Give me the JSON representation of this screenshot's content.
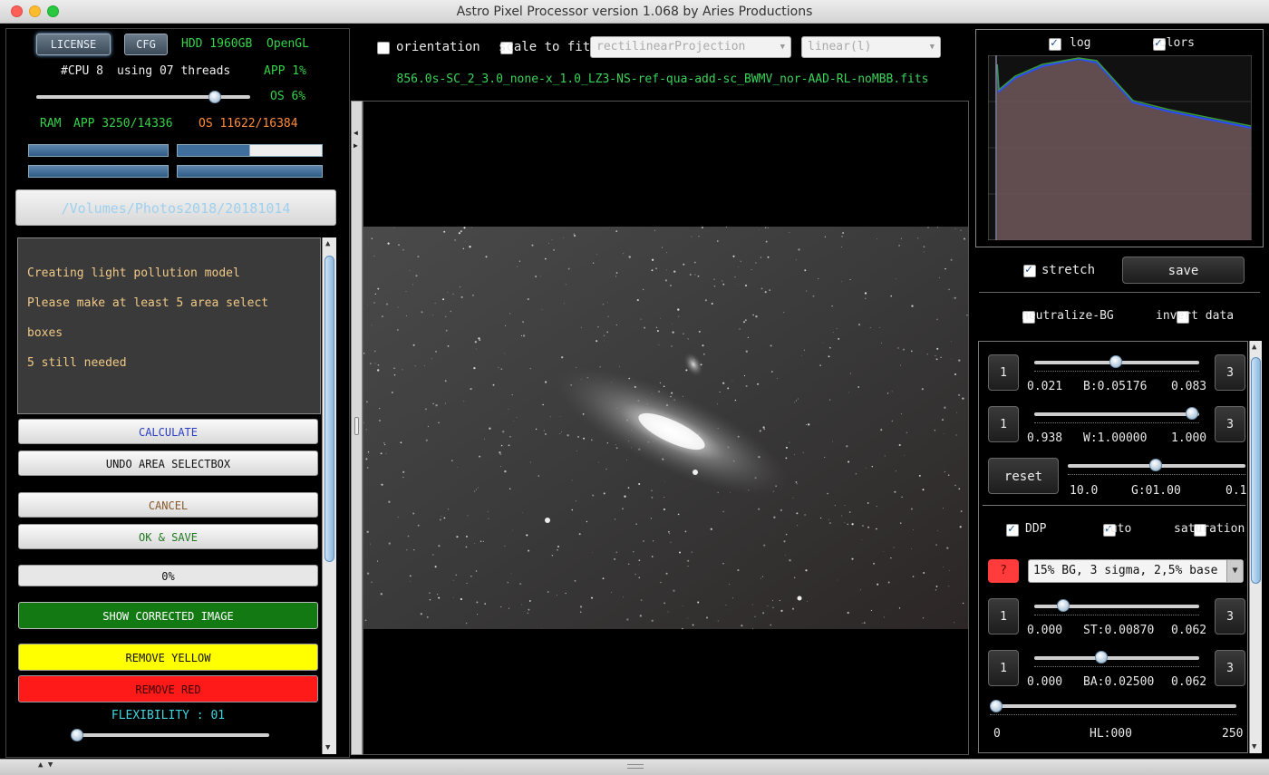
{
  "window": {
    "title": "Astro Pixel Processor version 1.068 by Aries Productions"
  },
  "top": {
    "license": "LICENSE",
    "cfg": "CFG",
    "hdd": "HDD 1960GB",
    "opengl": "OpenGL",
    "cpu": "#CPU 8",
    "threads": "using 07 threads",
    "app_pct": "APP 1%",
    "os_pct": "OS 6%",
    "ram": "RAM",
    "ram_app": "APP 3250/14336",
    "ram_os": "OS 11622/16384",
    "path": "/Volumes/Photos2018/20181014"
  },
  "log": {
    "lines": [
      "Creating light pollution model",
      "Please make at least 5 area select boxes",
      "5 still needed"
    ]
  },
  "actions": {
    "calculate": "CALCULATE",
    "undo": "UNDO AREA SELECTBOX",
    "cancel": "CANCEL",
    "ok_save": "OK & SAVE",
    "progress": "0%",
    "show_corrected": "SHOW CORRECTED IMAGE",
    "remove_yellow": "REMOVE YELLOW",
    "remove_red": "REMOVE RED",
    "flexibility": "FLEXIBILITY : 01"
  },
  "viewer": {
    "orientation": "orientation",
    "scale_to_fit": "scale to fit",
    "projection": "rectilinearProjection",
    "stretch_mode": "linear(l)",
    "filename": "856.0s-SC_2_3.0_none-x_1.0_LZ3-NS-ref-qua-add-sc_BWMV_nor-AAD-RL-noMBB.fits"
  },
  "histogram": {
    "log": "log",
    "colors": "colors"
  },
  "right": {
    "stretch": "stretch",
    "save": "save",
    "neutralize": "neutralize-BG",
    "invert": "invert data",
    "b_min": "0.021",
    "b_val": "B:0.05176",
    "b_max": "0.083",
    "w_min": "0.938",
    "w_val": "W:1.00000",
    "w_max": "1.000",
    "reset": "reset",
    "g_min": "10.0",
    "g_val": "G:01.00",
    "g_max": "0.1",
    "ddp": "DDP",
    "auto": "auto",
    "saturation": "saturation",
    "help": "?",
    "preset": "15% BG, 3 sigma, 2,5% base",
    "st_min": "0.000",
    "st_val": "ST:0.00870",
    "st_max": "0.062",
    "ba_min": "0.000",
    "ba_val": "BA:0.02500",
    "ba_max": "0.062",
    "hl_min": "0",
    "hl_val": "HL:000",
    "hl_max": "250",
    "one": "1",
    "three": "3"
  }
}
